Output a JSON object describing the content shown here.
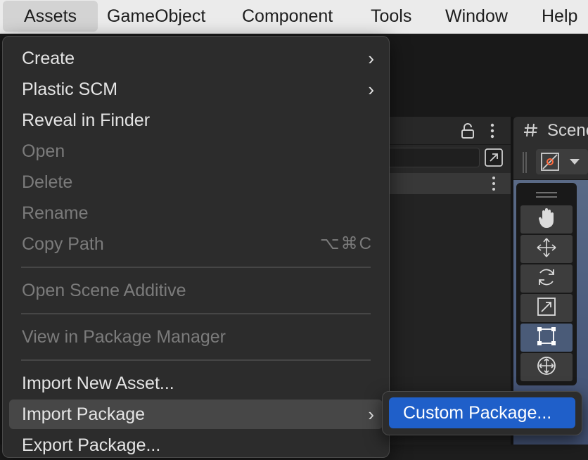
{
  "menubar": {
    "items": [
      {
        "label": "Assets",
        "active": true
      },
      {
        "label": "GameObject"
      },
      {
        "label": "Component"
      },
      {
        "label": "Tools"
      },
      {
        "label": "Window"
      },
      {
        "label": "Help"
      }
    ]
  },
  "scene": {
    "tab_label": "Scene",
    "tab_icon": "hash-icon"
  },
  "tools": [
    {
      "icon": "hand-tool-icon"
    },
    {
      "icon": "move-tool-icon"
    },
    {
      "icon": "rotate-tool-icon"
    },
    {
      "icon": "scale-tool-icon"
    },
    {
      "icon": "rect-tool-icon",
      "selected": true
    },
    {
      "icon": "transform-tool-icon"
    }
  ],
  "menu": {
    "items": {
      "create": {
        "label": "Create",
        "submenu": true
      },
      "plastic_scm": {
        "label": "Plastic SCM",
        "submenu": true
      },
      "reveal_in_finder": {
        "label": "Reveal in Finder"
      },
      "open": {
        "label": "Open",
        "disabled": true
      },
      "delete": {
        "label": "Delete",
        "disabled": true
      },
      "rename": {
        "label": "Rename",
        "disabled": true
      },
      "copy_path": {
        "label": "Copy Path",
        "disabled": true,
        "shortcut": "⌥⌘C"
      },
      "open_scene_additive": {
        "label": "Open Scene Additive",
        "disabled": true
      },
      "view_in_package_manager": {
        "label": "View in Package Manager",
        "disabled": true
      },
      "import_new_asset": {
        "label": "Import New Asset..."
      },
      "import_package": {
        "label": "Import Package",
        "submenu": true,
        "highlighted": true
      },
      "export_package": {
        "label": "Export Package..."
      }
    },
    "arrow_glyph": "›"
  },
  "submenu": {
    "custom_package": {
      "label": "Custom Package..."
    }
  },
  "colors": {
    "menu_bg": "#2c2c2c",
    "menu_highlight": "#474747",
    "submenu_selected": "#1f5fc9",
    "disabled_text": "#7b7b7b",
    "menubar_bg": "#ebebeb"
  }
}
